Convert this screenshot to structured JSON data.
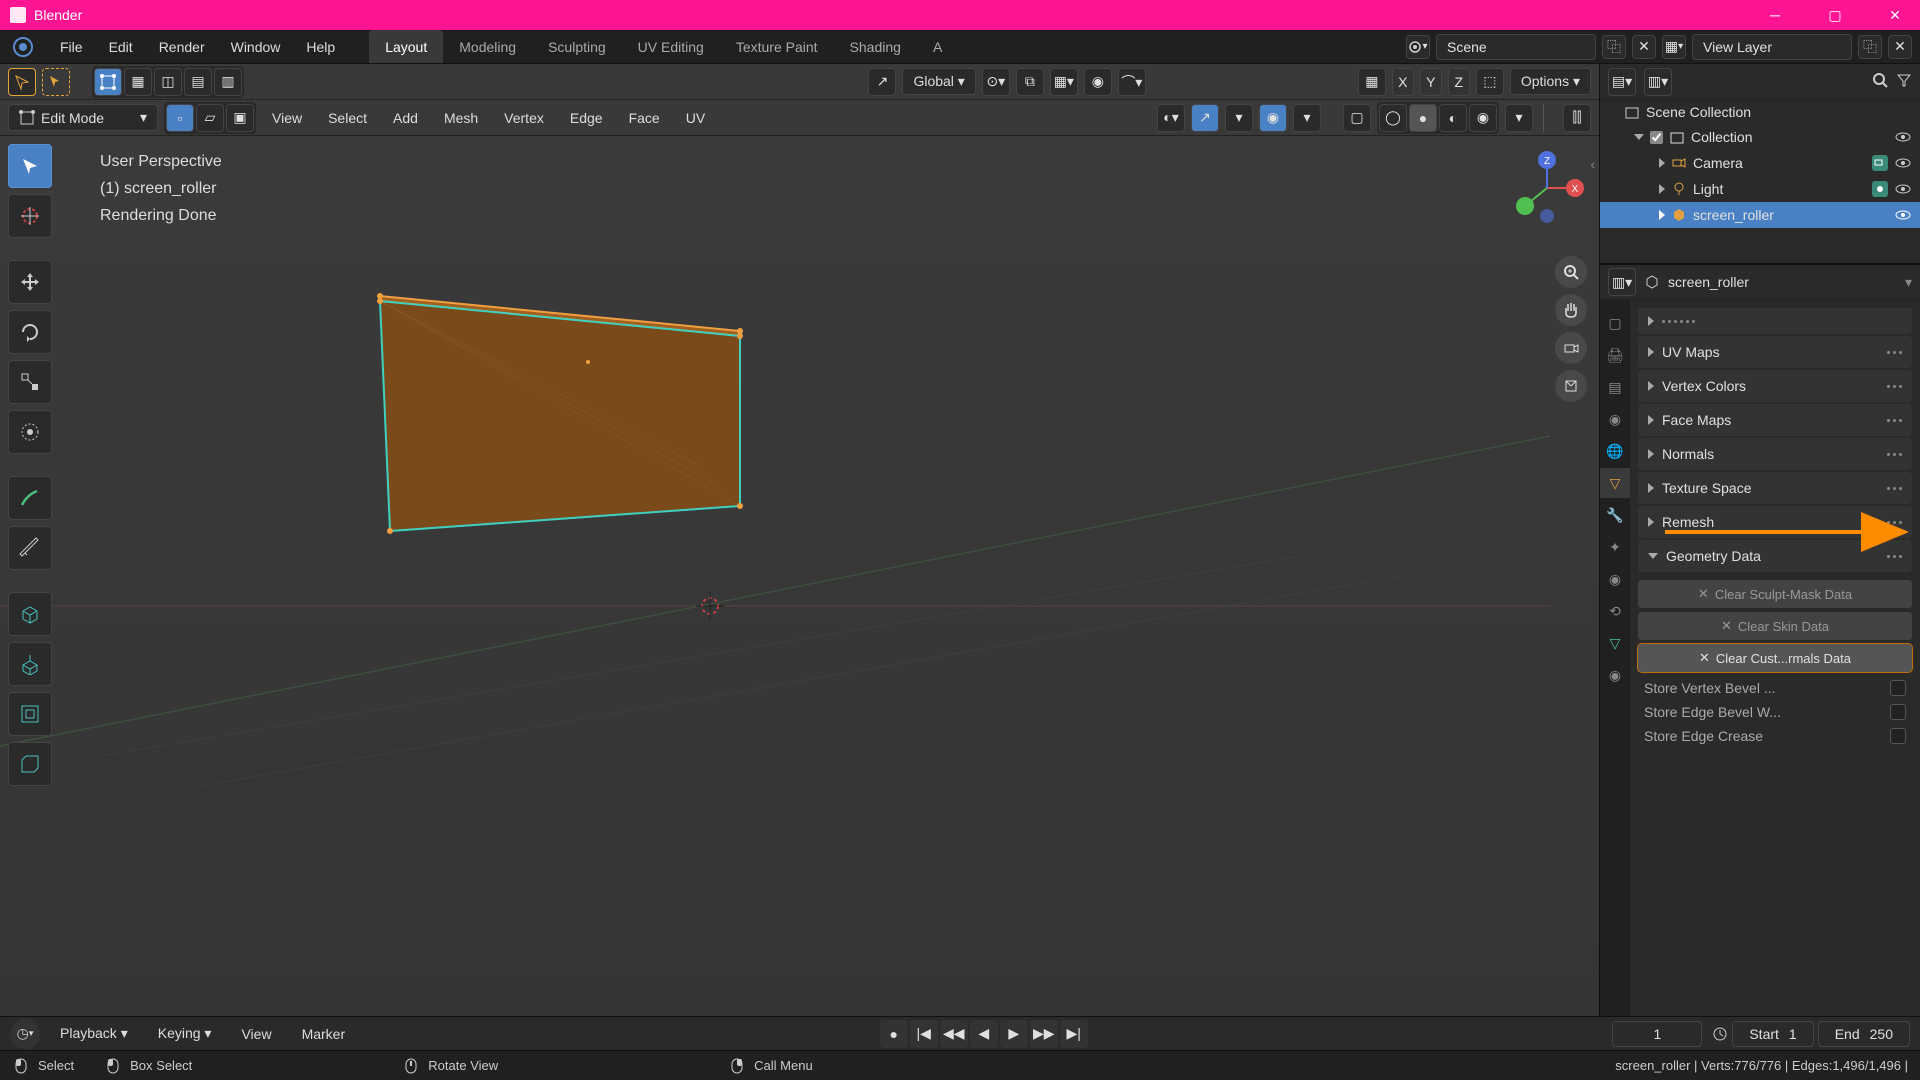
{
  "titlebar": {
    "app_name": "Blender"
  },
  "topmenu": {
    "file": "File",
    "edit": "Edit",
    "render": "Render",
    "window": "Window",
    "help": "Help"
  },
  "workspaces": {
    "layout": "Layout",
    "modeling": "Modeling",
    "sculpting": "Sculpting",
    "uv": "UV Editing",
    "texture": "Texture Paint",
    "shading": "Shading",
    "anim": "A"
  },
  "scene": {
    "scene_label": "Scene",
    "view_layer": "View Layer"
  },
  "toolbar3d": {
    "mode": "Edit Mode",
    "view": "View",
    "select": "Select",
    "add": "Add",
    "mesh": "Mesh",
    "vertex": "Vertex",
    "edge": "Edge",
    "face": "Face",
    "uv": "UV",
    "transform_orient": "Global",
    "options": "Options",
    "x": "X",
    "y": "Y",
    "z": "Z"
  },
  "viewport_info": {
    "l1": "User Perspective",
    "l2": "(1) screen_roller",
    "l3": "Rendering Done"
  },
  "outliner": {
    "scene_collection": "Scene Collection",
    "collection": "Collection",
    "camera": "Camera",
    "light": "Light",
    "roller": "screen_roller"
  },
  "properties": {
    "object_name": "screen_roller",
    "sections": {
      "uv_maps": "UV Maps",
      "vertex_colors": "Vertex Colors",
      "face_maps": "Face Maps",
      "normals": "Normals",
      "texture_space": "Texture Space",
      "remesh": "Remesh",
      "geometry_data": "Geometry Data"
    },
    "buttons": {
      "clear_sculpt": "Clear Sculpt-Mask Data",
      "clear_skin": "Clear Skin Data",
      "clear_normals": "Clear Cust...rmals Data",
      "store_vertex": "Store Vertex Bevel ...",
      "store_edge_bevel": "Store Edge Bevel W...",
      "store_edge_crease": "Store Edge Crease"
    }
  },
  "timeline": {
    "playback": "Playback",
    "keying": "Keying",
    "view": "View",
    "marker": "Marker",
    "current": "1",
    "start_label": "Start",
    "start": "1",
    "end_label": "End",
    "end": "250"
  },
  "statusbar": {
    "select": "Select",
    "box_select": "Box Select",
    "rotate_view": "Rotate View",
    "call_menu": "Call Menu",
    "stats": "screen_roller | Verts:776/776 | Edges:1,496/1,496 |"
  }
}
